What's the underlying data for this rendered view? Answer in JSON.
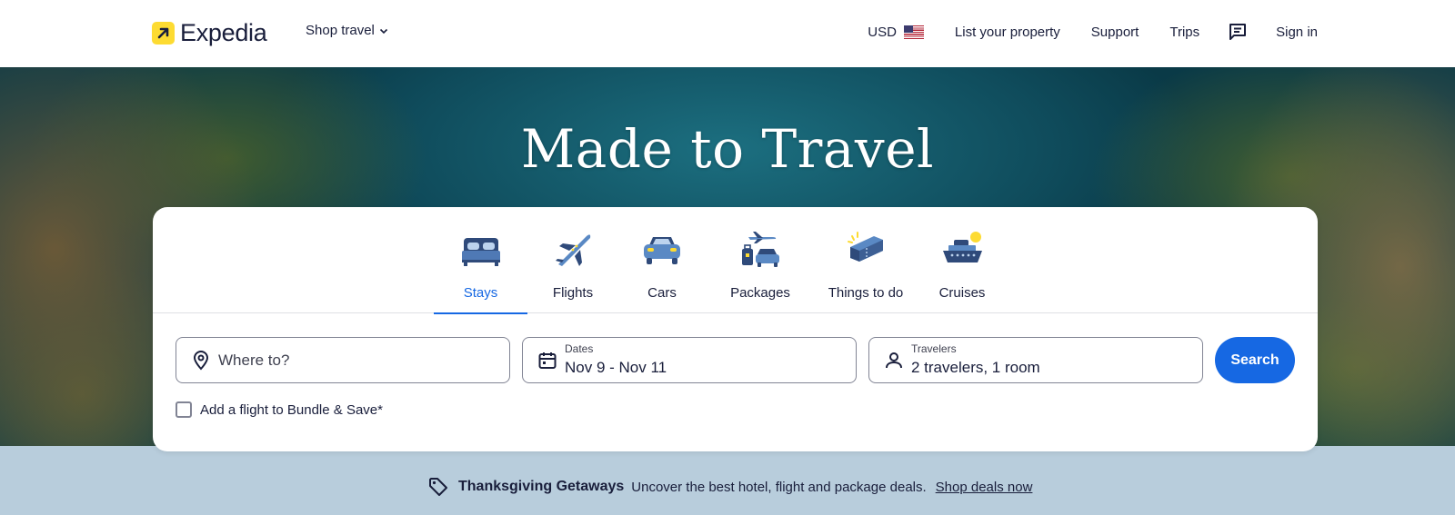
{
  "header": {
    "brand": "Expedia",
    "shop_travel": "Shop travel",
    "currency": "USD",
    "list_property": "List your property",
    "support": "Support",
    "trips": "Trips",
    "sign_in": "Sign in"
  },
  "hero": {
    "title": "Made to Travel"
  },
  "tabs": [
    {
      "label": "Stays",
      "icon": "bed-icon",
      "active": true
    },
    {
      "label": "Flights",
      "icon": "airplane-icon",
      "active": false
    },
    {
      "label": "Cars",
      "icon": "car-icon",
      "active": false
    },
    {
      "label": "Packages",
      "icon": "packages-icon",
      "active": false
    },
    {
      "label": "Things to do",
      "icon": "ticket-icon",
      "active": false
    },
    {
      "label": "Cruises",
      "icon": "cruise-ship-icon",
      "active": false
    }
  ],
  "search": {
    "destination_placeholder": "Where to?",
    "dates_label": "Dates",
    "dates_value": "Nov 9 - Nov 11",
    "travelers_label": "Travelers",
    "travelers_value": "2 travelers, 1 room",
    "button": "Search",
    "bundle_label": "Add a flight to Bundle & Save*",
    "bundle_checked": false
  },
  "promo": {
    "title": "Thanksgiving Getaways",
    "text": "Uncover the best hotel, flight and package deals.",
    "link": "Shop deals now"
  },
  "colors": {
    "brand_yellow": "#fddb32",
    "primary_blue": "#1668e3",
    "text_dark": "#191e3b",
    "promo_bg": "#b8cddc"
  }
}
